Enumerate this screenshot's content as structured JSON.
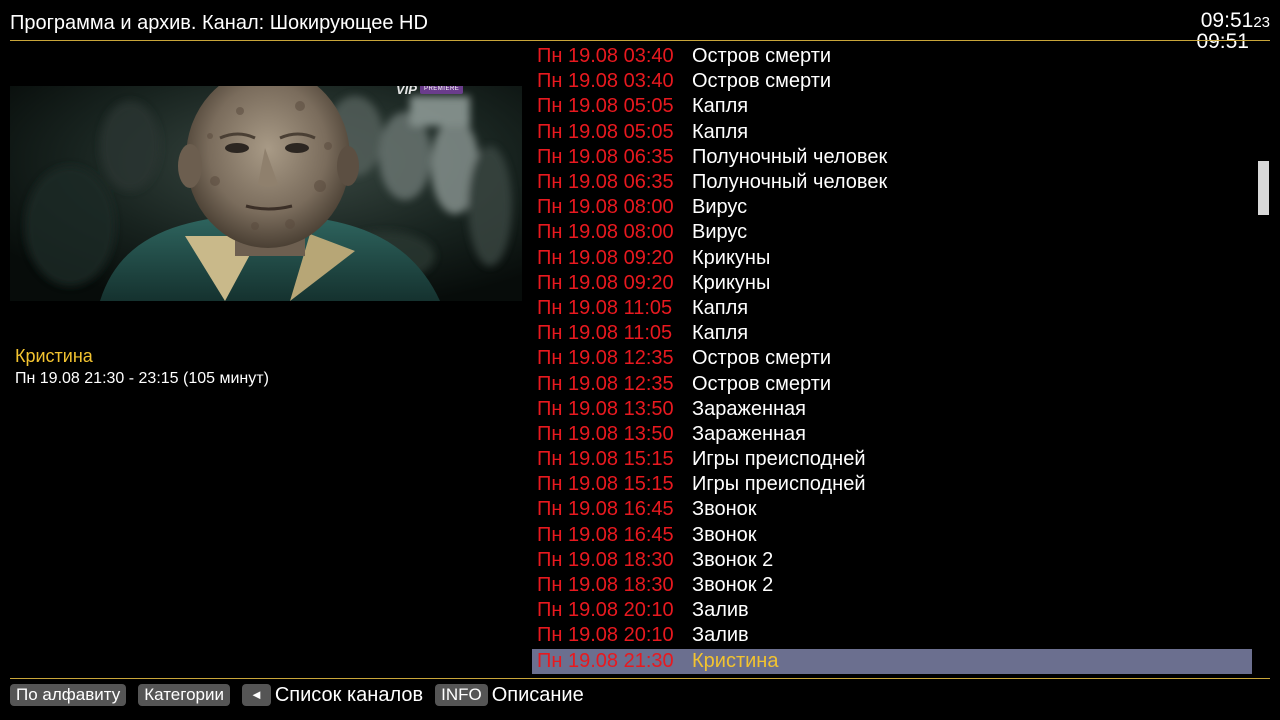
{
  "header": {
    "title": "Программа и архив. Канал: Шокирующее HD",
    "clock_hm": "09:51",
    "clock_sec": "23",
    "clock_secondary": "09:51"
  },
  "preview": {
    "logo_text": "VIP",
    "logo_badge": "PREMIERE"
  },
  "current_program": {
    "title": "Кристина",
    "time": "Пн 19.08 21:30 - 23:15 (105 минут)"
  },
  "schedule": [
    {
      "when": "Пн 19.08 03:40",
      "name": "Остров смерти"
    },
    {
      "when": "Пн 19.08 03:40",
      "name": "Остров смерти"
    },
    {
      "when": "Пн 19.08 05:05",
      "name": "Капля"
    },
    {
      "when": "Пн 19.08 05:05",
      "name": "Капля"
    },
    {
      "when": "Пн 19.08 06:35",
      "name": "Полуночный человек"
    },
    {
      "when": "Пн 19.08 06:35",
      "name": "Полуночный человек"
    },
    {
      "when": "Пн 19.08 08:00",
      "name": "Вирус"
    },
    {
      "when": "Пн 19.08 08:00",
      "name": "Вирус"
    },
    {
      "when": "Пн 19.08 09:20",
      "name": "Крикуны"
    },
    {
      "when": "Пн 19.08 09:20",
      "name": "Крикуны"
    },
    {
      "when": "Пн 19.08 11:05",
      "name": "Капля"
    },
    {
      "when": "Пн 19.08 11:05",
      "name": "Капля"
    },
    {
      "when": "Пн 19.08 12:35",
      "name": "Остров смерти"
    },
    {
      "when": "Пн 19.08 12:35",
      "name": "Остров смерти"
    },
    {
      "when": "Пн 19.08 13:50",
      "name": "Зараженная"
    },
    {
      "when": "Пн 19.08 13:50",
      "name": "Зараженная"
    },
    {
      "when": "Пн 19.08 15:15",
      "name": "Игры преисподней"
    },
    {
      "when": "Пн 19.08 15:15",
      "name": "Игры преисподней"
    },
    {
      "when": "Пн 19.08 16:45",
      "name": "Звонок"
    },
    {
      "when": "Пн 19.08 16:45",
      "name": "Звонок"
    },
    {
      "when": "Пн 19.08 18:30",
      "name": "Звонок 2"
    },
    {
      "when": "Пн 19.08 18:30",
      "name": "Звонок 2"
    },
    {
      "when": "Пн 19.08 20:10",
      "name": "Залив"
    },
    {
      "when": "Пн 19.08 20:10",
      "name": "Залив"
    },
    {
      "when": "Пн 19.08 21:30",
      "name": "Кристина",
      "selected": true
    }
  ],
  "footer": {
    "alphabet_key": "По алфавиту",
    "categories_key": "Категории",
    "left_key_icon": "left-arrow-icon",
    "left_key_glyph": "◄",
    "channels_label": "Список каналов",
    "info_key": "INFO",
    "description_label": "Описание"
  },
  "colors": {
    "accent_rule": "#c9a63a",
    "time_red": "#e8191f",
    "title_yellow": "#f2c330",
    "selection_bg": "#6b6f8f"
  }
}
